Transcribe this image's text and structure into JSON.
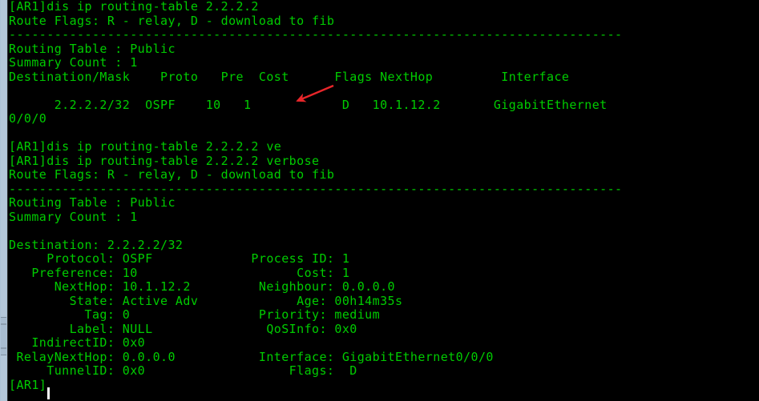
{
  "terminal": {
    "prompt": "[AR1]",
    "text_color": "#00cc00",
    "background_color": "#000000",
    "cursor_color": "#ffffff",
    "scrollbar_color": "#b4c7d9"
  },
  "annotation": {
    "arrow_color": "#e8262a",
    "name": "red-arrow-pointing-at-cost-value",
    "points_at": "Cost value 1 in routing table row"
  },
  "lines": [
    "[AR1]dis ip routing-table 2.2.2.2",
    "Route Flags: R - relay, D - download to fib",
    "---------------------------------------------------------------------------------",
    "Routing Table : Public",
    "Summary Count : 1",
    "Destination/Mask    Proto   Pre  Cost      Flags NextHop         Interface",
    "",
    "      2.2.2.2/32  OSPF    10   1            D   10.1.12.2       GigabitEthernet",
    "0/0/0",
    "",
    "[AR1]dis ip routing-table 2.2.2.2 ve",
    "[AR1]dis ip routing-table 2.2.2.2 verbose",
    "Route Flags: R - relay, D - download to fib",
    "---------------------------------------------------------------------------------",
    "Routing Table : Public",
    "Summary Count : 1",
    "",
    "Destination: 2.2.2.2/32",
    "     Protocol: OSPF             Process ID: 1",
    "   Preference: 10                     Cost: 1",
    "      NextHop: 10.1.12.2         Neighbour: 0.0.0.0",
    "        State: Active Adv             Age: 00h14m35s",
    "          Tag: 0                 Priority: medium",
    "        Label: NULL               QoSInfo: 0x0",
    "   IndirectID: 0x0",
    " RelayNextHop: 0.0.0.0           Interface: GigabitEthernet0/0/0",
    "     TunnelID: 0x0                   Flags:  D",
    "[AR1]"
  ],
  "commands": {
    "first_command": "dis ip routing-table 2.2.2.2",
    "partial_command": "dis ip routing-table 2.2.2.2 ve",
    "verbose_command": "dis ip routing-table 2.2.2.2 verbose"
  },
  "route_flags_legend": {
    "label": "Route Flags:",
    "relay": "R - relay",
    "download": "D - download to fib"
  },
  "routing_table_summary": {
    "table_label": "Routing Table :",
    "table_value": "Public",
    "count_label": "Summary Count :",
    "count_value": "1"
  },
  "route_table": {
    "headers": [
      "Destination/Mask",
      "Proto",
      "Pre",
      "Cost",
      "Flags",
      "NextHop",
      "Interface"
    ],
    "rows": [
      {
        "destination_mask": "2.2.2.2/32",
        "proto": "OSPF",
        "pre": "10",
        "cost": "1",
        "flags": "D",
        "nexthop": "10.1.12.2",
        "interface": "GigabitEthernet0/0/0"
      }
    ]
  },
  "verbose_detail": {
    "destination_label": "Destination:",
    "destination_value": "2.2.2.2/32",
    "fields": [
      {
        "left_label": "Protocol:",
        "left_value": "OSPF",
        "right_label": "Process ID:",
        "right_value": "1"
      },
      {
        "left_label": "Preference:",
        "left_value": "10",
        "right_label": "Cost:",
        "right_value": "1"
      },
      {
        "left_label": "NextHop:",
        "left_value": "10.1.12.2",
        "right_label": "Neighbour:",
        "right_value": "0.0.0.0"
      },
      {
        "left_label": "State:",
        "left_value": "Active Adv",
        "right_label": "Age:",
        "right_value": "00h14m35s"
      },
      {
        "left_label": "Tag:",
        "left_value": "0",
        "right_label": "Priority:",
        "right_value": "medium"
      },
      {
        "left_label": "Label:",
        "left_value": "NULL",
        "right_label": "QoSInfo:",
        "right_value": "0x0"
      },
      {
        "left_label": "IndirectID:",
        "left_value": "0x0",
        "right_label": "",
        "right_value": ""
      },
      {
        "left_label": "RelayNextHop:",
        "left_value": "0.0.0.0",
        "right_label": "Interface:",
        "right_value": "GigabitEthernet0/0/0"
      },
      {
        "left_label": "TunnelID:",
        "left_value": "0x0",
        "right_label": "Flags:",
        "right_value": "D"
      }
    ]
  }
}
